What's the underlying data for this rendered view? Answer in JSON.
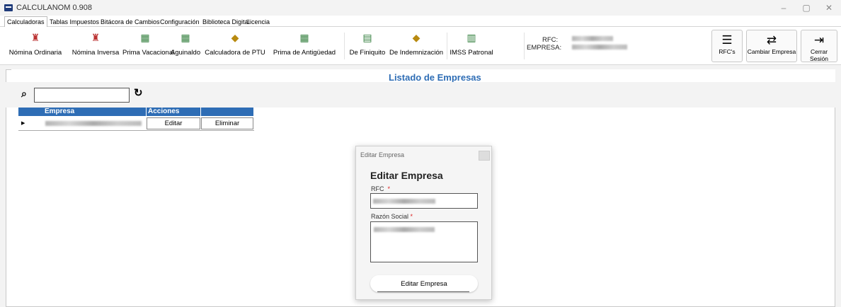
{
  "window": {
    "title": "CALCULANOM 0.908",
    "minimize_icon": "–",
    "restore_icon": "▢",
    "close_icon": "✕"
  },
  "menu_tabs": [
    "Calculadoras",
    "Tablas Impuestos",
    "Bitácora de Cambios",
    "Configuración",
    "Biblioteca Digital",
    "Licencia"
  ],
  "ribbon": {
    "buttons": [
      "Nómina Ordinaria",
      "Nómina Inversa",
      "Prima Vacacional",
      "Aguinaldo",
      "Calculadora de PTU",
      "Prima de Antigüedad",
      "De Finiquito",
      "De Indemnización",
      "IMSS Patronal"
    ],
    "rfc_label": "RFC:",
    "empresa_label": "EMPRESA:",
    "rfcs_label": "RFC's",
    "cambiar_label": "Cambiar Empresa",
    "cerrar_label": "Cerrar Sesión"
  },
  "list": {
    "title": "Listado de Empresas",
    "search_placeholder": ""
  },
  "grid": {
    "headers": [
      "Empresa",
      "Acciones",
      ""
    ],
    "row_selector": "▶",
    "edit_label": "Editar",
    "delete_label": "Eliminar"
  },
  "dialog": {
    "window_title": "Editar Empresa",
    "heading": "Editar Empresa",
    "rfc_label": "RFC",
    "razon_label": "Razón Social",
    "required_mark": "*",
    "submit_label": "Editar Empresa"
  },
  "colors": {
    "accent": "#2e6db5",
    "required": "#dd2222"
  }
}
